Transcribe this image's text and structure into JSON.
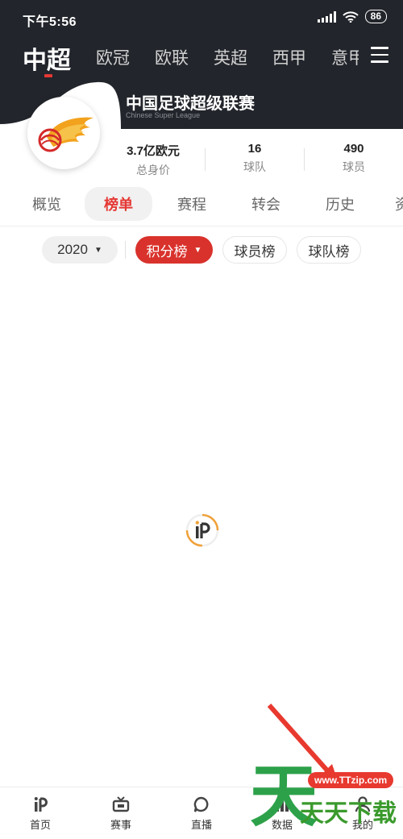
{
  "status_bar": {
    "time": "下午5:56",
    "battery": "86",
    "icons": [
      "signal-icon",
      "wifi-icon",
      "battery-icon"
    ]
  },
  "league_tabs": {
    "items": [
      "中超",
      "欧冠",
      "欧联",
      "英超",
      "西甲",
      "意甲"
    ],
    "active": "中超"
  },
  "league": {
    "name": "中国足球超级联赛",
    "subtitle": "Chinese Super League"
  },
  "stats": [
    {
      "value": "3.7亿欧元",
      "label": "总身价"
    },
    {
      "value": "16",
      "label": "球队"
    },
    {
      "value": "490",
      "label": "球员"
    }
  ],
  "subtabs": {
    "items": [
      "概览",
      "榜单",
      "赛程",
      "转会",
      "历史",
      "资"
    ],
    "active": "榜单"
  },
  "filters": {
    "year": "2020",
    "ranking_types": [
      "积分榜",
      "球员榜",
      "球队榜"
    ],
    "active": "积分榜"
  },
  "bottom_nav": {
    "items": [
      {
        "label": "首页",
        "icon": "home-logo-icon"
      },
      {
        "label": "赛事",
        "icon": "tv-icon"
      },
      {
        "label": "直播",
        "icon": "chat-bubble-icon"
      },
      {
        "label": "数据",
        "icon": "bar-chart-icon"
      },
      {
        "label": "我的",
        "icon": "person-icon"
      }
    ]
  },
  "watermark": {
    "url": "www.TTzip.com",
    "text": "天天下载",
    "big_char": "天"
  },
  "colors": {
    "header_bg": "#22252b",
    "accent_red": "#d9322c",
    "watermark_green": "#2da14a"
  }
}
